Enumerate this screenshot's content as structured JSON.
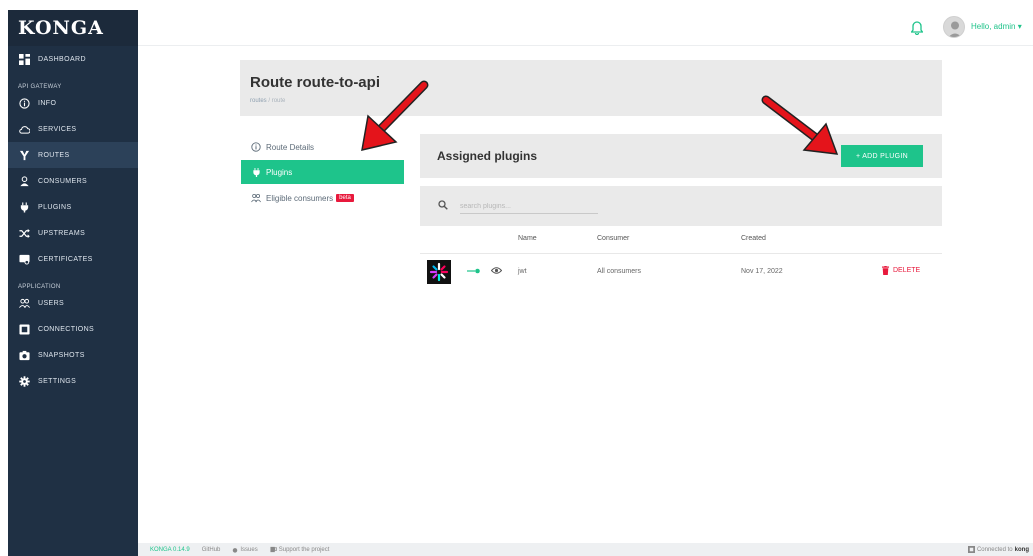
{
  "sidebar": {
    "brand": "KONGA",
    "items": [
      {
        "label": "DASHBOARD",
        "icon": "dashboard-icon"
      },
      {
        "section": "API GATEWAY"
      },
      {
        "label": "INFO",
        "icon": "info-icon"
      },
      {
        "label": "SERVICES",
        "icon": "cloud-icon"
      },
      {
        "label": "ROUTES",
        "icon": "routes-icon",
        "active": true
      },
      {
        "label": "CONSUMERS",
        "icon": "user-icon"
      },
      {
        "label": "PLUGINS",
        "icon": "plug-icon"
      },
      {
        "label": "UPSTREAMS",
        "icon": "shuffle-icon"
      },
      {
        "label": "CERTIFICATES",
        "icon": "certificate-icon"
      },
      {
        "section": "APPLICATION"
      },
      {
        "label": "USERS",
        "icon": "users-icon"
      },
      {
        "label": "CONNECTIONS",
        "icon": "connections-icon"
      },
      {
        "label": "SNAPSHOTS",
        "icon": "camera-icon"
      },
      {
        "label": "SETTINGS",
        "icon": "gear-icon"
      }
    ]
  },
  "topbar": {
    "greeting": "Hello, admin ▾"
  },
  "page": {
    "title": "Route route-to-api",
    "breadcrumb": [
      "routes",
      "route"
    ]
  },
  "menu": {
    "route_details": "Route Details",
    "plugins": "Plugins",
    "eligible_consumers": "Eligible consumers",
    "beta": "beta"
  },
  "panel": {
    "title": "Assigned plugins",
    "add_button": "+ ADD PLUGIN",
    "search_placeholder": "search plugins..."
  },
  "table": {
    "headers": [
      "Name",
      "Consumer",
      "Created"
    ],
    "rows": [
      {
        "name": "jwt",
        "consumer": "All consumers",
        "created": "Nov 17, 2022",
        "action": "DELETE"
      }
    ]
  },
  "footer": {
    "version": "KONGA 0.14.9",
    "github": "GitHub",
    "issues": "Issues",
    "support": "Support the project",
    "connected_prefix": "Connected to",
    "connected_to": "kong"
  },
  "colors": {
    "sidebar_bg": "#1f3044",
    "accent_green": "#1ec48b",
    "danger_red": "#e8193c",
    "panel_gray": "#eaeaea"
  }
}
